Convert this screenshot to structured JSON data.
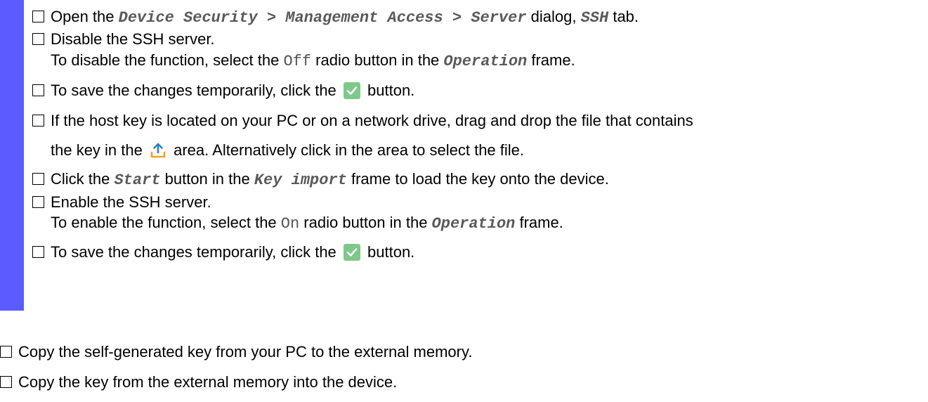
{
  "steps_indented": {
    "s1": {
      "p1": "Open the ",
      "ui1": "Device Security > Management Access > Server",
      "p2": " dialog, ",
      "ui2": "SSH",
      "p3": " tab."
    },
    "s2": {
      "text": "Disable the SSH server."
    },
    "s2b": {
      "p1": "To disable the function, select the ",
      "code": "Off",
      "p2": " radio button in the ",
      "ui": "Operation",
      "p3": " frame."
    },
    "s3": {
      "p1": "To save the changes temporarily, click the ",
      "p2": " button.",
      "icon": "check-icon"
    },
    "s4": {
      "text": "If the host key is located on your PC or on a network drive, drag and drop the file that contains"
    },
    "s4b": {
      "p1": "the key in the ",
      "p2": " area. Alternatively click in the area to select the file.",
      "icon": "upload-icon"
    },
    "s5": {
      "p1": "Click the ",
      "ui1": "Start",
      "p2": " button in the ",
      "ui2": "Key import",
      "p3": " frame to load the key onto the device."
    },
    "s6": {
      "text": "Enable the SSH server."
    },
    "s6b": {
      "p1": "To enable the function, select the ",
      "code": "On",
      "p2": " radio button in the ",
      "ui": "Operation",
      "p3": " frame."
    },
    "s7": {
      "p1": "To save the changes temporarily, click the ",
      "p2": " button.",
      "icon": "check-icon"
    }
  },
  "steps_outer": {
    "o1": {
      "text": "Copy the self-generated key from your PC to the external memory."
    },
    "o2": {
      "text": "Copy the key from the external memory into the device."
    }
  },
  "colors": {
    "accent_bar": "#5a5cff",
    "check_button": "#7ec98a",
    "upload_icon": "#2f7fc1"
  }
}
